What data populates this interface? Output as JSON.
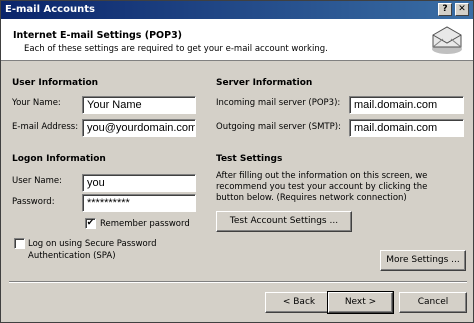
{
  "window": {
    "title": "E-mail Accounts",
    "help_btn": "?",
    "close_btn": "✕"
  },
  "header": {
    "title": "Internet E-mail Settings (POP3)",
    "subtitle": "Each of these settings are required to get your e-mail account working."
  },
  "user_info": {
    "heading": "User Information",
    "name_label": "Your Name:",
    "name_value": "Your Name",
    "email_label": "E-mail Address:",
    "email_value": "you@yourdomain.com"
  },
  "server_info": {
    "heading": "Server Information",
    "incoming_label": "Incoming mail server (POP3):",
    "incoming_value": "mail.domain.com",
    "outgoing_label": "Outgoing mail server (SMTP):",
    "outgoing_value": "mail.domain.com"
  },
  "logon_info": {
    "heading": "Logon Information",
    "username_label": "User Name:",
    "username_value": "you",
    "password_label": "Password:",
    "password_value": "**********",
    "remember_label": "Remember password",
    "remember_checked": "✔",
    "spa_label_line1": "Log on using Secure Password",
    "spa_label_line2": "Authentication (SPA)"
  },
  "test_settings": {
    "heading": "Test Settings",
    "description": "After filling out the information on this screen, we recommend you test your account by clicking the button below. (Requires network connection)",
    "test_button": "Test Account Settings ..."
  },
  "buttons": {
    "more_settings": "More Settings ...",
    "back": "< Back",
    "next": "Next >",
    "cancel": "Cancel"
  }
}
